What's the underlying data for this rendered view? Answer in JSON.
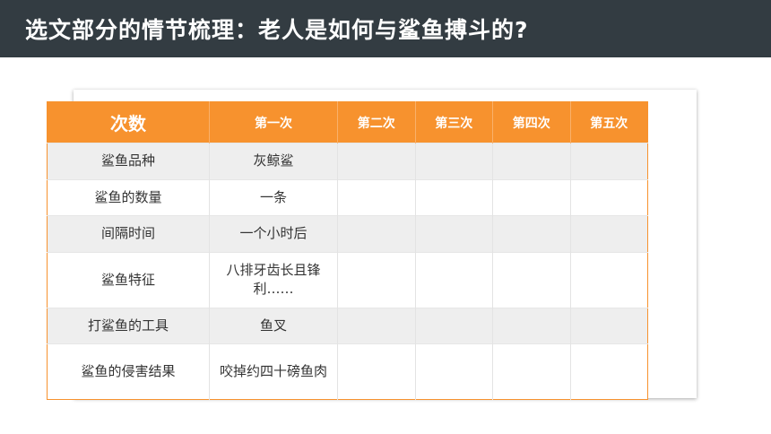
{
  "title": "选文部分的情节梳理：老人是如何与鲨鱼搏斗的?",
  "table": {
    "headers": [
      "次数",
      "第一次",
      "第二次",
      "第三次",
      "第四次",
      "第五次"
    ],
    "rows": [
      {
        "label": "鲨鱼品种",
        "first": "灰鲸鲨"
      },
      {
        "label": "鲨鱼的数量",
        "first": "一条"
      },
      {
        "label": "间隔时间",
        "first": "一个小时后"
      },
      {
        "label": "鲨鱼特征",
        "first": "八排牙齿长且锋利……"
      },
      {
        "label": "打鲨鱼的工具",
        "first": "鱼叉"
      },
      {
        "label": "鲨鱼的侵害结果",
        "first": "咬掉约四十磅鱼肉"
      }
    ]
  },
  "colors": {
    "title_bar": "#333c42",
    "accent": "#f7922e",
    "row_alt": "#eeeeee"
  }
}
